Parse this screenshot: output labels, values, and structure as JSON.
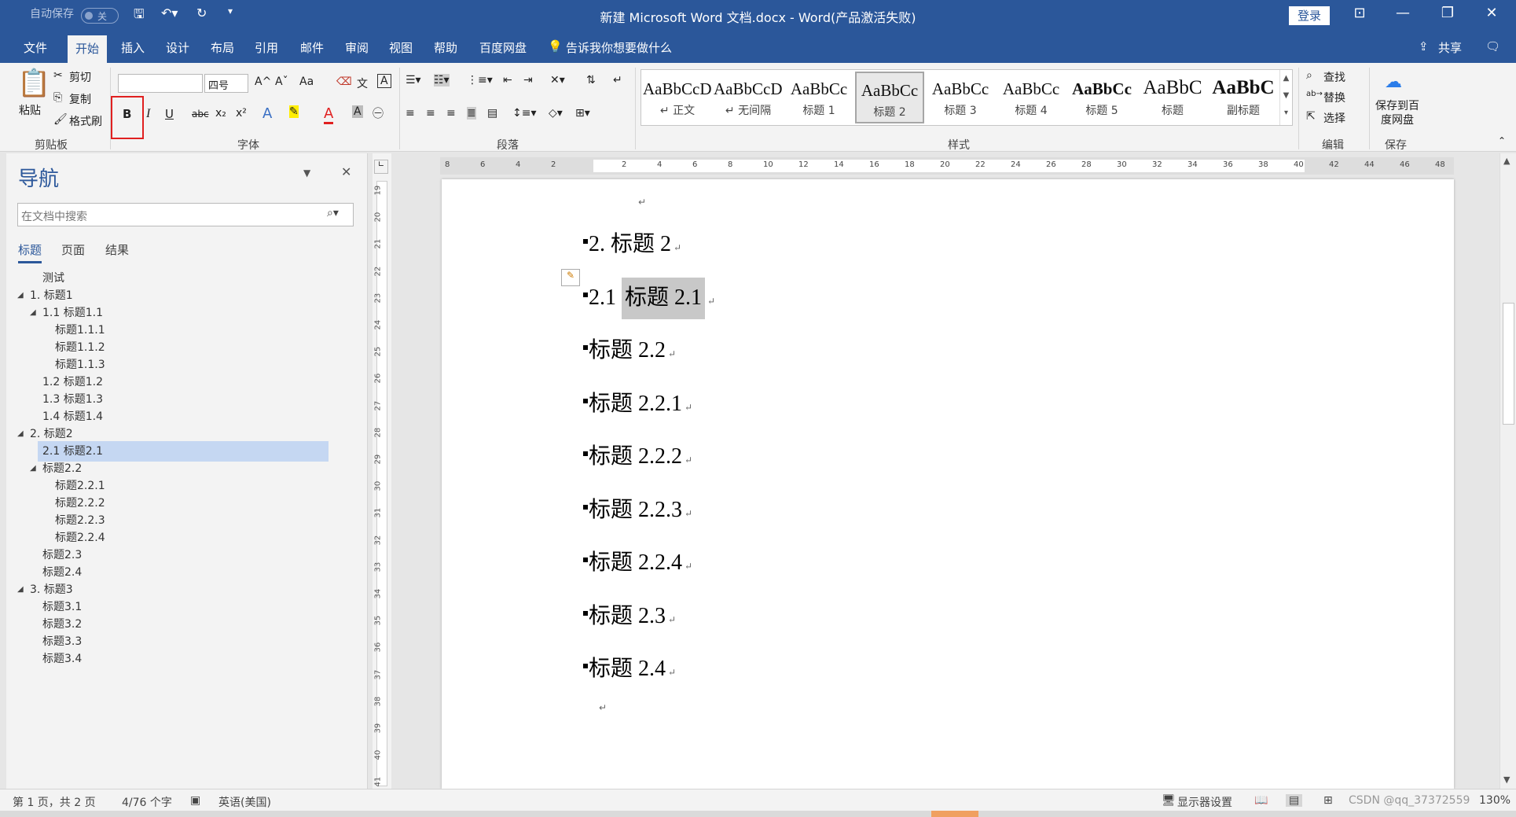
{
  "titlebar": {
    "autosave": "自动保存",
    "autosave_state": "关",
    "title": "新建 Microsoft Word 文档.docx  -  Word(产品激活失败)",
    "login": "登录"
  },
  "tabs": [
    "文件",
    "开始",
    "插入",
    "设计",
    "布局",
    "引用",
    "邮件",
    "审阅",
    "视图",
    "帮助",
    "百度网盘"
  ],
  "tell_me": "告诉我你想要做什么",
  "share": "共享",
  "clipboard": {
    "paste": "粘贴",
    "cut": "剪切",
    "copy": "复制",
    "format_painter": "格式刷",
    "group": "剪贴板"
  },
  "font": {
    "font_name": "",
    "font_size": "四号",
    "group": "字体",
    "bold": "B",
    "italic": "I",
    "underline": "U",
    "strike": "abc",
    "sub": "x₂",
    "sup": "x²",
    "aa": "Aa",
    "grow": "A^",
    "shrink": "Aˇ"
  },
  "paragraph": {
    "group": "段落"
  },
  "styles": {
    "group": "样式",
    "items": [
      {
        "sample": "AaBbCcDc",
        "name": "↵ 正文"
      },
      {
        "sample": "AaBbCcDc",
        "name": "↵ 无间隔"
      },
      {
        "sample": "AaBbCc",
        "name": "标题 1"
      },
      {
        "sample": "AaBbCc",
        "name": "标题 2"
      },
      {
        "sample": "AaBbCc",
        "name": "标题 3"
      },
      {
        "sample": "AaBbCc",
        "name": "标题 4"
      },
      {
        "sample": "AaBbCc",
        "name": "标题 5"
      },
      {
        "sample": "AaBbC",
        "name": "标题"
      },
      {
        "sample": "AaBbC",
        "name": "副标题"
      }
    ]
  },
  "editing": {
    "find": "查找",
    "replace": "替换",
    "select": "选择",
    "group": "编辑"
  },
  "save": {
    "label": "保存到百度网盘",
    "group": "保存"
  },
  "nav": {
    "title": "导航",
    "search_placeholder": "在文档中搜索",
    "tabs": [
      "标题",
      "页面",
      "结果"
    ],
    "items": [
      {
        "label": "测试",
        "level": 1,
        "expander": ""
      },
      {
        "label": "1. 标题1",
        "level": 0,
        "expander": "◢"
      },
      {
        "label": "1.1 标题1.1",
        "level": 1,
        "expander": "◢"
      },
      {
        "label": "标题1.1.1",
        "level": 2,
        "expander": ""
      },
      {
        "label": "标题1.1.2",
        "level": 2,
        "expander": ""
      },
      {
        "label": "标题1.1.3",
        "level": 2,
        "expander": ""
      },
      {
        "label": "1.2 标题1.2",
        "level": 1,
        "expander": ""
      },
      {
        "label": "1.3 标题1.3",
        "level": 1,
        "expander": ""
      },
      {
        "label": "1.4 标题1.4",
        "level": 1,
        "expander": ""
      },
      {
        "label": "2. 标题2",
        "level": 0,
        "expander": "◢"
      },
      {
        "label": "2.1 标题2.1",
        "level": 1,
        "expander": "",
        "selected": true
      },
      {
        "label": "标题2.2",
        "level": 1,
        "expander": "◢"
      },
      {
        "label": "标题2.2.1",
        "level": 2,
        "expander": ""
      },
      {
        "label": "标题2.2.2",
        "level": 2,
        "expander": ""
      },
      {
        "label": "标题2.2.3",
        "level": 2,
        "expander": ""
      },
      {
        "label": "标题2.2.4",
        "level": 2,
        "expander": ""
      },
      {
        "label": "标题2.3",
        "level": 1,
        "expander": ""
      },
      {
        "label": "标题2.4",
        "level": 1,
        "expander": ""
      },
      {
        "label": "3. 标题3",
        "level": 0,
        "expander": "◢"
      },
      {
        "label": "标题3.1",
        "level": 1,
        "expander": ""
      },
      {
        "label": "标题3.2",
        "level": 1,
        "expander": ""
      },
      {
        "label": "标题3.3",
        "level": 1,
        "expander": ""
      },
      {
        "label": "标题3.4",
        "level": 1,
        "expander": ""
      }
    ]
  },
  "hruler_nums": [
    "8",
    "6",
    "4",
    "2",
    "",
    "2",
    "4",
    "6",
    "8",
    "10",
    "12",
    "14",
    "16",
    "18",
    "20",
    "22",
    "24",
    "26",
    "28",
    "30",
    "32",
    "34",
    "36",
    "38",
    "40",
    "42",
    "44",
    "46",
    "48"
  ],
  "vruler_nums": [
    "19",
    "20",
    "21",
    "22",
    "23",
    "24",
    "25",
    "26",
    "27",
    "28",
    "29",
    "30",
    "31",
    "32",
    "33",
    "34",
    "35",
    "36",
    "37",
    "38",
    "39",
    "40",
    "41"
  ],
  "document": {
    "headings": [
      {
        "text": "2.  标题 2"
      },
      {
        "text": "2.1  ",
        "hl": "标题 2.1"
      },
      {
        "text": "标题 2.2"
      },
      {
        "text": "标题 2.2.1"
      },
      {
        "text": "标题 2.2.2"
      },
      {
        "text": "标题 2.2.3"
      },
      {
        "text": "标题 2.2.4"
      },
      {
        "text": "标题 2.3"
      },
      {
        "text": "标题 2.4"
      }
    ],
    "para_mark": "↵"
  },
  "status": {
    "page": "第 1 页，共 2 页",
    "words": "4/76 个字",
    "lang": "英语(美国)",
    "display": "显示器设置",
    "zoom": "130%",
    "watermark": "CSDN @qq_37372559"
  }
}
